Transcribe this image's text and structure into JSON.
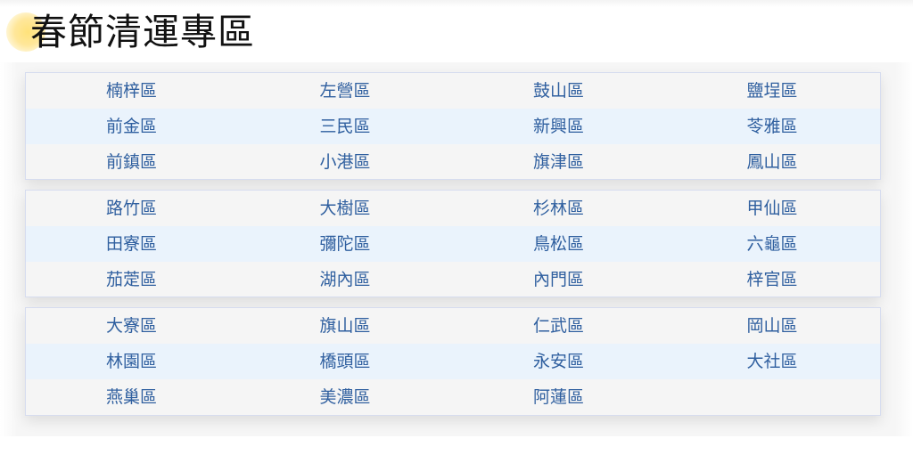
{
  "page": {
    "title": "春節清運專區"
  },
  "groups": [
    {
      "rows": [
        [
          "楠梓區",
          "左營區",
          "鼓山區",
          "鹽埕區"
        ],
        [
          "前金區",
          "三民區",
          "新興區",
          "苓雅區"
        ],
        [
          "前鎮區",
          "小港區",
          "旗津區",
          "鳳山區"
        ]
      ]
    },
    {
      "rows": [
        [
          "路竹區",
          "大樹區",
          "杉林區",
          "甲仙區"
        ],
        [
          "田寮區",
          "彌陀區",
          "鳥松區",
          "六龜區"
        ],
        [
          "茄萣區",
          "湖內區",
          "內門區",
          "梓官區"
        ]
      ]
    },
    {
      "rows": [
        [
          "大寮區",
          "旗山區",
          "仁武區",
          "岡山區"
        ],
        [
          "林園區",
          "橋頭區",
          "永安區",
          "大社區"
        ],
        [
          "燕巢區",
          "美濃區",
          "阿蓮區",
          ""
        ]
      ]
    }
  ],
  "colors": {
    "link": "#2f5f9f",
    "alt_row": "#eaf3fc",
    "panel": "#f5f5f5",
    "accent_dot": "#ffe27a"
  }
}
